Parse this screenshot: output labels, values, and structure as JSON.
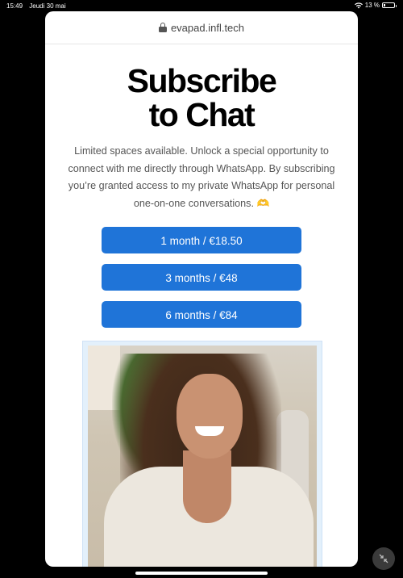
{
  "status_bar": {
    "time": "15:49",
    "date": "Jeudi 30 mai",
    "battery_text": "13 %",
    "battery_level": 0.13,
    "icons": [
      "wifi-icon",
      "battery-icon"
    ]
  },
  "browser": {
    "url": "evapad.infl.tech",
    "lock_icon": "lock-icon"
  },
  "page": {
    "title_line1": "Subscribe",
    "title_line2": "to Chat",
    "description": "Limited spaces available. Unlock a special opportunity to connect with me directly through WhatsApp. By subscribing you’re granted access to my private WhatsApp for personal one-on-one conversations. 🫶",
    "plans": [
      {
        "label": "1 month / €18.50"
      },
      {
        "label": "3 months / €48"
      },
      {
        "label": "6 months / €84"
      }
    ],
    "accent_color": "#1f74d8"
  },
  "system": {
    "pip_icon": "minimize-arrows-icon"
  }
}
